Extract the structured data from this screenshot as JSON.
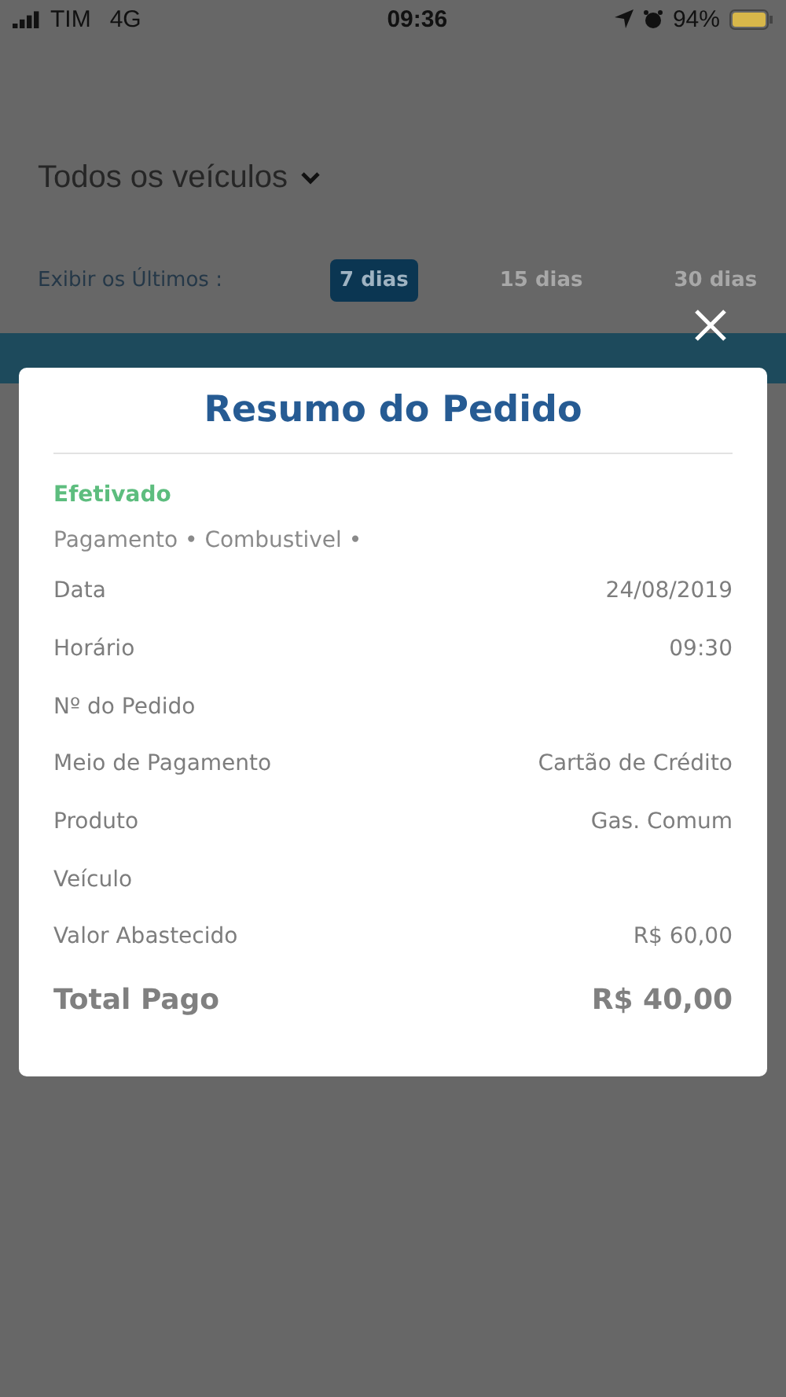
{
  "status_bar": {
    "carrier": "TIM",
    "network": "4G",
    "time": "09:36",
    "battery": "94%"
  },
  "vehicle_selector": {
    "label": "Todos os veículos"
  },
  "period_filter": {
    "label": "Exibir os Últimos :",
    "options": [
      {
        "label": "7 dias",
        "selected": true
      },
      {
        "label": "15 dias",
        "selected": false
      },
      {
        "label": "30 dias",
        "selected": false
      }
    ]
  },
  "modal": {
    "title": "Resumo do Pedido",
    "status": "Efetivado",
    "subtitle": "Pagamento • Combustivel •",
    "rows": [
      {
        "label": "Data",
        "value": "24/08/2019"
      },
      {
        "label": "Horário",
        "value": "09:30"
      },
      {
        "label": "Nº do Pedido"
      },
      {
        "label": "Meio de Pagamento",
        "value": "Cartão de Crédito"
      },
      {
        "label": "Produto",
        "value": "Gas. Comum"
      },
      {
        "label": "Veículo"
      },
      {
        "label": "Valor Abastecido",
        "value": "R$ 60,00"
      }
    ],
    "total": {
      "label": "Total Pago",
      "value": "R$ 40,00"
    }
  }
}
